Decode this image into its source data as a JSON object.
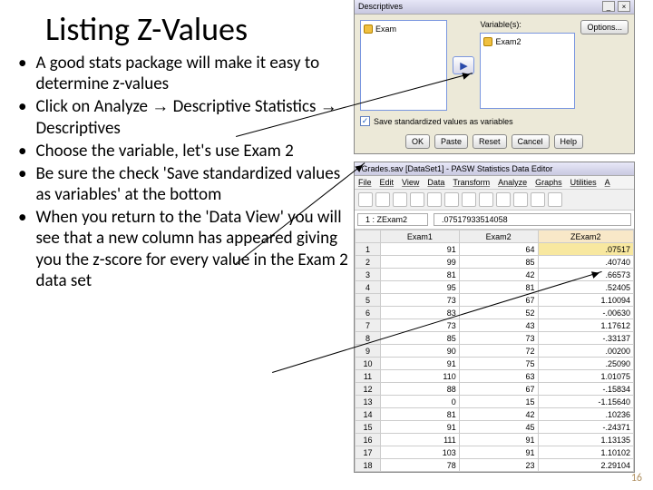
{
  "title": "Listing Z-Values",
  "bullets": [
    "A good stats package will make it easy to determine z-values",
    "Click on Analyze → Descriptive Statistics → Descriptives",
    "Choose the variable, let's use Exam 2",
    "Be sure the check 'Save standardized values as variables' at the bottom",
    "When you return to  the 'Data View' you will see that a new column has appeared giving you the z-score for every value in the Exam 2 data set"
  ],
  "dialog": {
    "title": "Descriptives",
    "left_item": "Exam",
    "vars_label": "Variable(s):",
    "right_item": "Exam2",
    "options_btn": "Options...",
    "checkbox": "Save standardized values as variables",
    "buttons": [
      "OK",
      "Paste",
      "Reset",
      "Cancel",
      "Help"
    ]
  },
  "editor": {
    "title": "*Grades.sav [DataSet1] - PASW Statistics Data Editor",
    "menus": [
      "File",
      "Edit",
      "View",
      "Data",
      "Transform",
      "Analyze",
      "Graphs",
      "Utilities",
      "A"
    ],
    "cell_ref": "1 : ZExam2",
    "cell_val": ".07517933514058",
    "cols": [
      "Exam1",
      "Exam2",
      "ZExam2"
    ],
    "rows": [
      [
        "1",
        "91",
        "64",
        ".07517"
      ],
      [
        "2",
        "99",
        "85",
        ".40740"
      ],
      [
        "3",
        "81",
        "42",
        ".66573"
      ],
      [
        "4",
        "95",
        "81",
        ".52405"
      ],
      [
        "5",
        "73",
        "67",
        "1.10094"
      ],
      [
        "6",
        "83",
        "52",
        "-.00630"
      ],
      [
        "7",
        "73",
        "43",
        "1.17612"
      ],
      [
        "8",
        "85",
        "73",
        "-.33137"
      ],
      [
        "9",
        "90",
        "72",
        ".00200"
      ],
      [
        "10",
        "91",
        "75",
        ".25090"
      ],
      [
        "11",
        "110",
        "63",
        "1.01075"
      ],
      [
        "12",
        "88",
        "67",
        "-.15834"
      ],
      [
        "13",
        "0",
        "15",
        "-1.15640"
      ],
      [
        "14",
        "81",
        "42",
        ".10236"
      ],
      [
        "15",
        "91",
        "45",
        "-.24371"
      ],
      [
        "16",
        "111",
        "91",
        "1.13135"
      ],
      [
        "17",
        "103",
        "91",
        "1.10102"
      ],
      [
        "18",
        "78",
        "23",
        "2.29104"
      ]
    ]
  },
  "pagenum": "16"
}
